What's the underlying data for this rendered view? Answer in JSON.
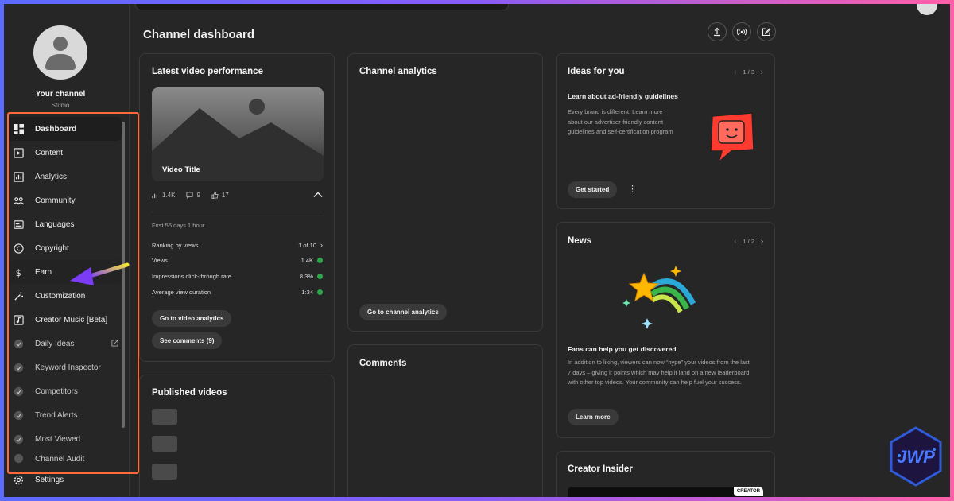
{
  "colors": {
    "highlight_border": "#ff6a3d",
    "arrow_gradient_start": "#f5e63a",
    "arrow_head": "#7b3cf5",
    "check": "#2ba84a",
    "idea_illustration": "#ff3b2f",
    "news_star": "#ffb800"
  },
  "channel": {
    "name": "Your channel",
    "subtitle": "Studio"
  },
  "sidebar": {
    "items": [
      {
        "label": "Dashboard",
        "icon": "dashboard-icon"
      },
      {
        "label": "Content",
        "icon": "content-icon"
      },
      {
        "label": "Analytics",
        "icon": "analytics-icon"
      },
      {
        "label": "Community",
        "icon": "community-icon"
      },
      {
        "label": "Languages",
        "icon": "languages-icon"
      },
      {
        "label": "Copyright",
        "icon": "copyright-icon"
      },
      {
        "label": "Earn",
        "icon": "dollar-icon"
      },
      {
        "label": "Customization",
        "icon": "magic-wand-icon"
      },
      {
        "label": "Creator Music [Beta]",
        "icon": "music-icon"
      },
      {
        "label": "Daily Ideas",
        "icon": "extension-icon"
      },
      {
        "label": "Keyword Inspector",
        "icon": "extension-icon"
      },
      {
        "label": "Competitors",
        "icon": "extension-icon"
      },
      {
        "label": "Trend Alerts",
        "icon": "extension-icon"
      },
      {
        "label": "Most Viewed",
        "icon": "extension-icon"
      },
      {
        "label": "Channel Audit",
        "icon": "extension-icon"
      }
    ],
    "settings_label": "Settings"
  },
  "header": {
    "title": "Channel dashboard"
  },
  "latest_video": {
    "title": "Latest video performance",
    "video_title": "Video Title",
    "views": "1.4K",
    "comments": "9",
    "likes": "17",
    "period": "First 55 days 1 hour",
    "metrics": [
      {
        "label": "Ranking by views",
        "value": "1 of 10"
      },
      {
        "label": "Views",
        "value": "1.4K"
      },
      {
        "label": "Impressions click-through rate",
        "value": "8.3%"
      },
      {
        "label": "Average view duration",
        "value": "1:34"
      }
    ],
    "btn_analytics": "Go to video analytics",
    "btn_comments": "See comments (9)"
  },
  "published": {
    "title": "Published videos"
  },
  "channel_analytics": {
    "title": "Channel analytics",
    "btn": "Go to channel analytics"
  },
  "comments": {
    "title": "Comments"
  },
  "ideas": {
    "title": "Ideas for you",
    "pager": "1 / 3",
    "subtitle": "Learn about ad-friendly guidelines",
    "text": "Every brand is different. Learn more about our advertiser-friendly content guidelines and self-certification program",
    "btn": "Get started"
  },
  "news": {
    "title": "News",
    "pager": "1 / 2",
    "subtitle": "Fans can help you get discovered",
    "text": "In addition to liking, viewers can now “hype” your videos from the last 7 days – giving it points which may help it land on a new leaderboard with other top videos. Your community can help fuel your success.",
    "btn": "Learn more"
  },
  "creator_insider": {
    "title": "Creator Insider",
    "tag": "CREATOR"
  },
  "watermark": {
    "text": "JWP"
  }
}
